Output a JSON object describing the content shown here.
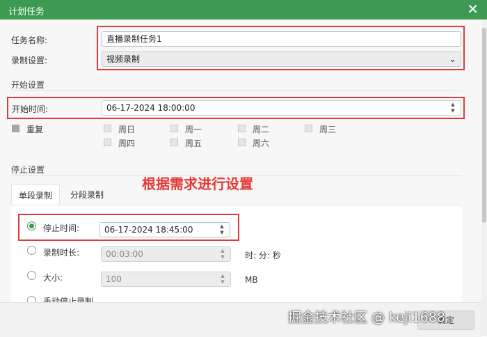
{
  "window": {
    "title": "计划任务",
    "close_glyph": "✕"
  },
  "form": {
    "task_name_label": "任务名称:",
    "task_name_value": "直播录制任务1",
    "record_setting_label": "录制设置:",
    "record_setting_value": "视频录制"
  },
  "start": {
    "section_title": "开始设置",
    "start_time_label": "开始时间:",
    "start_time_value": "06-17-2024 18:00:00",
    "repeat_label": "重复",
    "days": [
      "周日",
      "周一",
      "周二",
      "周三",
      "周四",
      "周五",
      "周六"
    ]
  },
  "stop": {
    "section_title": "停止设置",
    "tabs": [
      "单段录制",
      "分段录制"
    ],
    "stop_time_label": "停止时间:",
    "stop_time_value": "06-17-2024 18:45:00",
    "duration_label": "录制时长:",
    "duration_value": "00:03:00",
    "duration_unit": "时: 分: 秒",
    "size_label": "大小:",
    "size_value": "100",
    "size_unit": "MB",
    "manual_label": "手动停止录制"
  },
  "annotation": "根据需求进行设置",
  "watermark": "掘金技术社区 @ keji1688",
  "ok_button": "确定",
  "colors": {
    "title_bar": "#3d9a52",
    "highlight": "#e03a3a",
    "annotation": "#e53935"
  }
}
